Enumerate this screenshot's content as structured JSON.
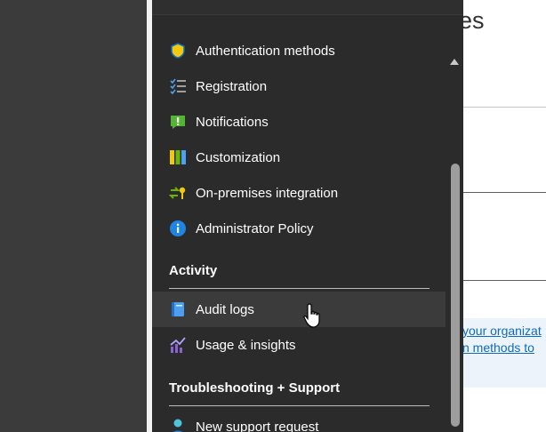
{
  "background_page": {
    "title_fragment": "ies",
    "link_line_1": "your organizat",
    "link_line_2": "n methods to"
  },
  "menu": {
    "items_top": [
      {
        "label": "Authentication methods",
        "icon": "shield-icon"
      },
      {
        "label": "Registration",
        "icon": "checklist-icon"
      },
      {
        "label": "Notifications",
        "icon": "notification-icon"
      },
      {
        "label": "Customization",
        "icon": "customization-icon"
      },
      {
        "label": "On-premises integration",
        "icon": "on-premises-icon"
      },
      {
        "label": "Administrator Policy",
        "icon": "info-icon"
      }
    ],
    "activity": {
      "header": "Activity",
      "items": [
        {
          "label": "Audit logs",
          "icon": "audit-log-icon"
        },
        {
          "label": "Usage & insights",
          "icon": "insights-chart-icon"
        }
      ]
    },
    "troubleshooting": {
      "header": "Troubleshooting + Support",
      "items": [
        {
          "label": "New support request",
          "icon": "support-person-icon"
        }
      ]
    }
  },
  "colors": {
    "menu_bg": "#2b2b2b",
    "hover_bg": "#3b3b3b",
    "text": "#ffffff",
    "link": "#0f6cbd"
  }
}
